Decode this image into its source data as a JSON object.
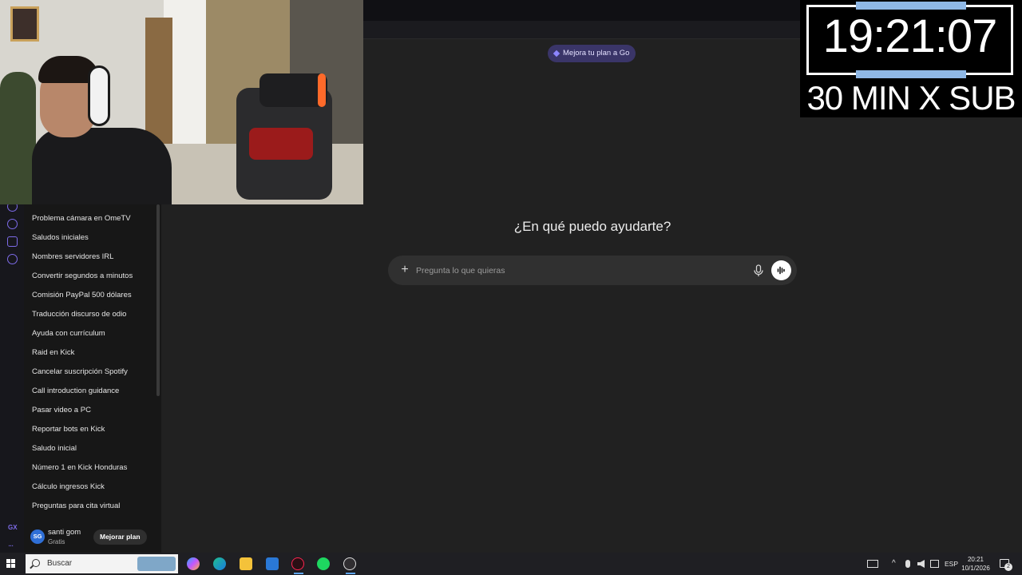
{
  "sidebar": {
    "chats": [
      {
        "label": "Problema cámara en OmeTV"
      },
      {
        "label": "Saludos iniciales"
      },
      {
        "label": "Nombres servidores IRL"
      },
      {
        "label": "Convertir segundos a minutos"
      },
      {
        "label": "Comisión PayPal 500 dólares"
      },
      {
        "label": "Traducción discurso de odio"
      },
      {
        "label": "Ayuda con currículum"
      },
      {
        "label": "Raid en Kick"
      },
      {
        "label": "Cancelar suscripción Spotify"
      },
      {
        "label": "Call introduction guidance"
      },
      {
        "label": "Pasar video a PC"
      },
      {
        "label": "Reportar bots en Kick"
      },
      {
        "label": "Saludo inicial"
      },
      {
        "label": "Número 1 en Kick Honduras"
      },
      {
        "label": "Cálculo ingresos Kick"
      },
      {
        "label": "Preguntas para cita virtual"
      }
    ],
    "user": {
      "initials": "SG",
      "name": "santi gom",
      "plan": "Gratis",
      "upgrade_label": "Mejorar plan"
    }
  },
  "browser": {
    "gx_label": "GX",
    "more_label": "..."
  },
  "main": {
    "upgrade_pill": "Mejora tu plan a Go",
    "greeting": "¿En qué puedo ayudarte?",
    "composer": {
      "placeholder": "Pregunta lo que quieras",
      "value": ""
    }
  },
  "overlay": {
    "timer": "19:21:07",
    "promo": "30 MIN X SUB"
  },
  "taskbar": {
    "search_label": "Buscar",
    "apps": [
      "copilot-icon",
      "edge-icon",
      "file-explorer-icon",
      "mail-icon",
      "opera-gx-icon",
      "spotify-icon",
      "obs-icon"
    ],
    "language": "ESP",
    "time": "20:21",
    "date": "10/1/2026",
    "notifications": "2"
  },
  "colors": {
    "accent": "#7d6be8",
    "pill_bg": "#3a3568",
    "page_bg": "#212121",
    "sidebar_bg": "#171717"
  }
}
